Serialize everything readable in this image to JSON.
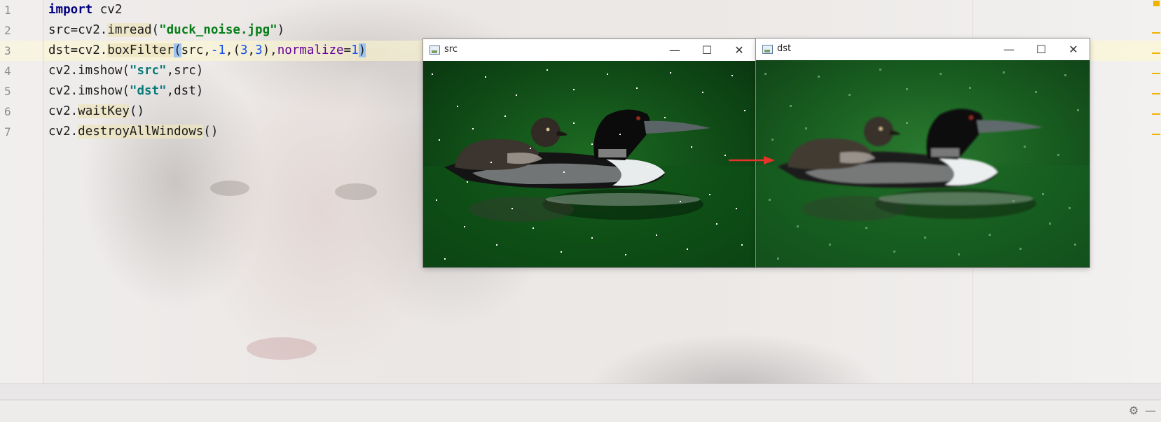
{
  "editor": {
    "line_numbers": [
      "1",
      "2",
      "3",
      "4",
      "5",
      "6",
      "7"
    ],
    "code": {
      "l1": {
        "kw": "import",
        "rest": " cv2"
      },
      "l2": {
        "pre": "src=cv2.",
        "fn": "imread",
        "open": "(",
        "str": "\"duck_noise.jpg\"",
        "close": ")"
      },
      "l3": {
        "pre": "dst=cv2.",
        "fn": "boxFilter",
        "open": "(",
        "a": "src,",
        "n1": "-1",
        "c1": ",(",
        "n2": "3",
        "c2": ",",
        "n3": "3",
        "c3": "),",
        "kwarg": "normalize",
        "eq": "=",
        "n4": "1",
        "close": ")"
      },
      "l4": {
        "pre": "cv2.imshow(",
        "str": "\"src\"",
        "post": ",src)"
      },
      "l5": {
        "pre": "cv2.imshow(",
        "str": "\"dst\"",
        "post": ",dst)"
      },
      "l6": {
        "pre": "cv2.",
        "fn": "waitKey",
        "post": "()"
      },
      "l7": {
        "pre": "cv2.",
        "fn": "destroyAllWindows",
        "post": "()"
      }
    }
  },
  "windows": {
    "src": {
      "title": "src",
      "minimize": "—",
      "maximize": "☐",
      "close": "✕"
    },
    "dst": {
      "title": "dst",
      "minimize": "—",
      "maximize": "☐",
      "close": "✕"
    }
  },
  "bottom_bar": {
    "settings_icon": "gear-icon",
    "minimize_icon": "minimize-icon"
  },
  "colors": {
    "accent_arrow": "#e8322a",
    "scroll_marker": "#f0b400",
    "keyword": "#000080",
    "string": "#067d17",
    "number": "#1750eb"
  }
}
